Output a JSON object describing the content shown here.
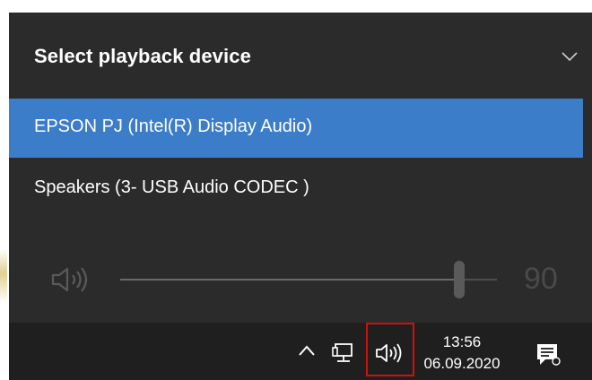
{
  "flyout": {
    "title": "Select playback device",
    "devices": [
      {
        "label": "EPSON PJ (Intel(R) Display Audio)",
        "selected": true
      },
      {
        "label": "Speakers (3- USB Audio CODEC )",
        "selected": false
      }
    ],
    "volume": {
      "value": "90",
      "level": 90
    }
  },
  "taskbar": {
    "clock": {
      "time": "13:56",
      "date": "06.09.2020"
    },
    "icons": {
      "tray_chevron": "chevron-up-icon",
      "network": "network-wired-icon",
      "volume": "speaker-icon",
      "notifications": "action-center-icon"
    }
  },
  "colors": {
    "flyout_bg": "#2b2b2b",
    "selected_bg": "#3b7dc8",
    "taskbar_bg": "#1f1f1f",
    "highlight_box": "#d01010"
  }
}
